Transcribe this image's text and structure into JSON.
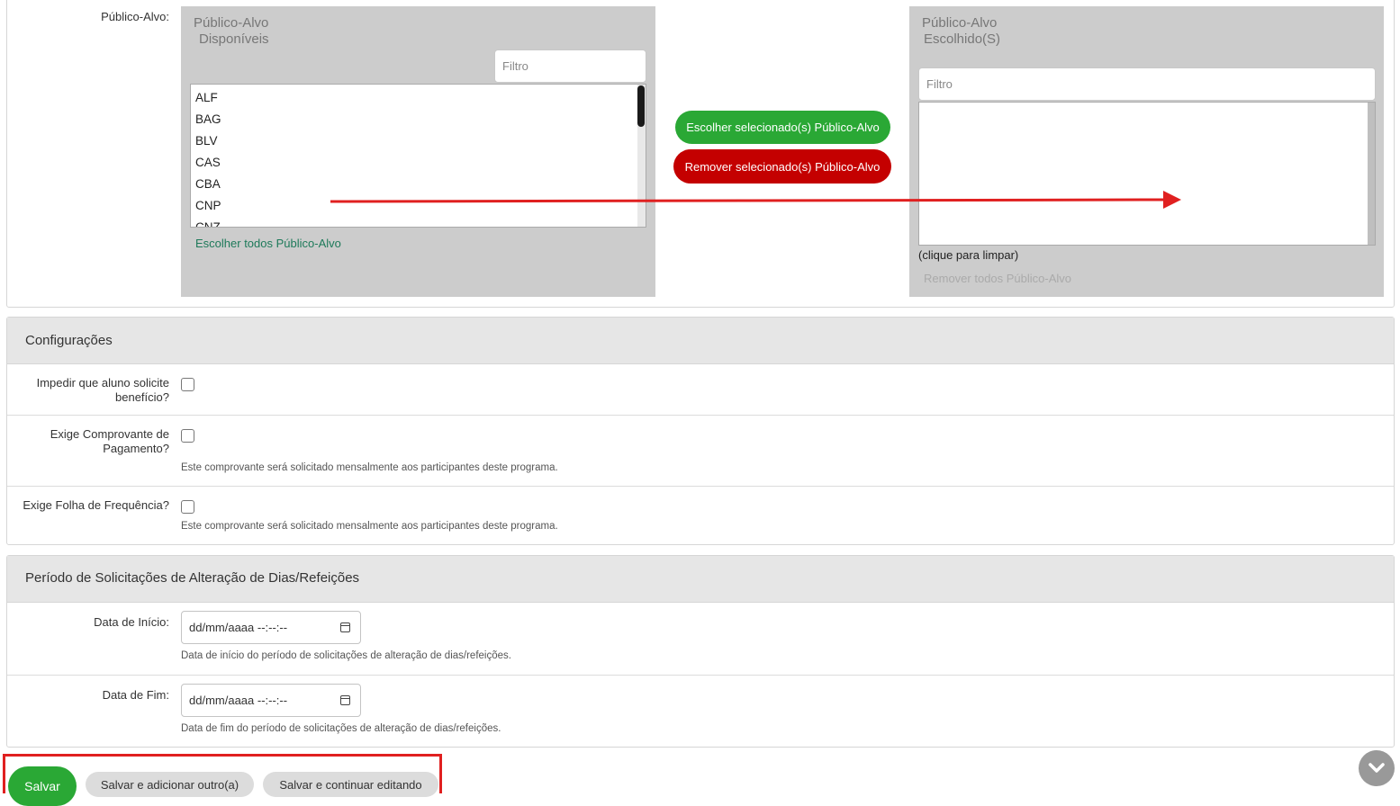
{
  "publico_alvo": {
    "label": "Público-Alvo:",
    "available": {
      "title_line1": "Público-Alvo",
      "title_line2": "Disponíveis",
      "filter_placeholder": "Filtro",
      "options": [
        "ALF",
        "BAG",
        "BLV",
        "CAS",
        "CBA",
        "CNP",
        "CNZ"
      ],
      "choose_all_label": "Escolher todos Público-Alvo"
    },
    "choose_selected_label": "Escolher selecionado(s) Público-Alvo",
    "remove_selected_label": "Remover selecionado(s) Público-Alvo",
    "chosen": {
      "title_line1": "Público-Alvo",
      "title_line2": "Escolhido(S)",
      "filter_placeholder": "Filtro",
      "clear_hint": "(clique para limpar)",
      "remove_all_label": "Remover todos Público-Alvo"
    }
  },
  "configuracoes": {
    "title": "Configurações",
    "impedir_label_line1": "Impedir que aluno solicite",
    "impedir_label_line2": "benefício?",
    "comprovante_label_line1": "Exige Comprovante de",
    "comprovante_label_line2": "Pagamento?",
    "comprovante_help": "Este comprovante será solicitado mensalmente aos participantes deste programa.",
    "folha_label": "Exige Folha de Frequência?",
    "folha_help": "Este comprovante será solicitado mensalmente aos participantes deste programa."
  },
  "periodo": {
    "title": "Período de Solicitações de Alteração de Dias/Refeições",
    "inicio_label": "Data de Início:",
    "inicio_value": "dd/mm/aaaa --:--:--",
    "inicio_help": "Data de início do período de solicitações de alteração de dias/refeições.",
    "fim_label": "Data de Fim:",
    "fim_value": "dd/mm/aaaa --:--:--",
    "fim_help": "Data de fim do período de solicitações de alteração de dias/refeições."
  },
  "actions": {
    "save_label": "Salvar",
    "save_add_label": "Salvar e adicionar outro(a)",
    "save_continue_label": "Salvar e continuar editando"
  },
  "colors": {
    "green": "#2aa835",
    "red": "#c40000",
    "annotation_red": "#e02020"
  }
}
